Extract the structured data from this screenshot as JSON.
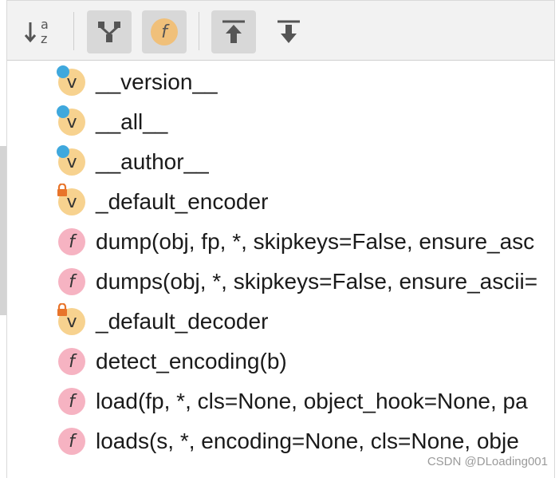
{
  "toolbar": {
    "buttons": [
      {
        "name": "sort-alphabetically",
        "icon": "sort-az-icon",
        "active": false
      },
      {
        "name": "show-inherited",
        "icon": "hierarchy-icon",
        "active": true
      },
      {
        "name": "show-fields",
        "icon": "f-icon",
        "active": true
      },
      {
        "name": "navigate-up",
        "icon": "arrow-up-icon",
        "active": true
      },
      {
        "name": "navigate-down",
        "icon": "arrow-down-icon",
        "active": false
      }
    ],
    "sort_glyph_a": "a",
    "sort_glyph_z": "z",
    "field_glyph": "f"
  },
  "items": [
    {
      "kind": "variable",
      "badge": "public",
      "icon_letter": "v",
      "text": "__version__"
    },
    {
      "kind": "variable",
      "badge": "public",
      "icon_letter": "v",
      "text": "__all__"
    },
    {
      "kind": "variable",
      "badge": "public",
      "icon_letter": "v",
      "text": "__author__"
    },
    {
      "kind": "variable",
      "badge": "private",
      "icon_letter": "v",
      "text": "_default_encoder"
    },
    {
      "kind": "function",
      "badge": "none",
      "icon_letter": "f",
      "text": "dump(obj, fp, *, skipkeys=False, ensure_asc"
    },
    {
      "kind": "function",
      "badge": "none",
      "icon_letter": "f",
      "text": "dumps(obj, *, skipkeys=False, ensure_ascii="
    },
    {
      "kind": "variable",
      "badge": "private",
      "icon_letter": "v",
      "text": "_default_decoder"
    },
    {
      "kind": "function",
      "badge": "none",
      "icon_letter": "f",
      "text": "detect_encoding(b)"
    },
    {
      "kind": "function",
      "badge": "none",
      "icon_letter": "f",
      "text": "load(fp, *, cls=None, object_hook=None, pa"
    },
    {
      "kind": "function",
      "badge": "none",
      "icon_letter": "f",
      "text": "loads(s, *, encoding=None, cls=None, obje"
    }
  ],
  "colors": {
    "variable_icon": "#f7d28f",
    "function_icon": "#f6b3c2",
    "public_badge": "#3fa8dd",
    "lock_badge": "#e8742a"
  },
  "watermark": "CSDN @DLoading001"
}
